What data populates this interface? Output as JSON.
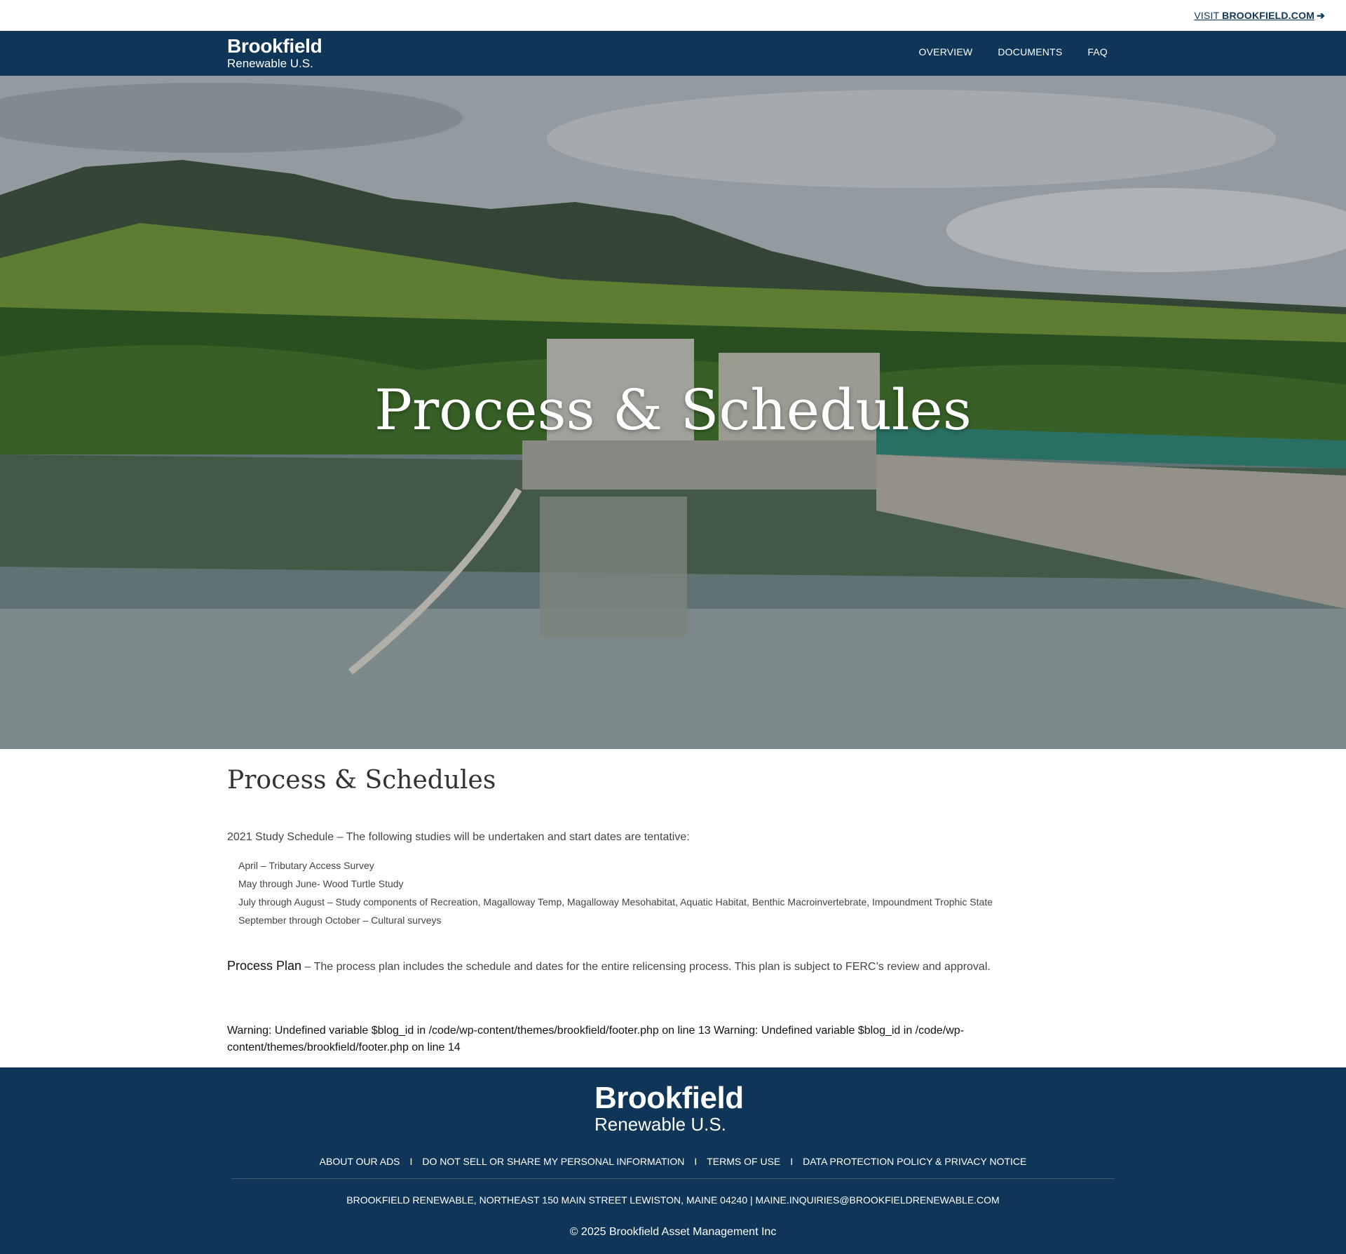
{
  "topbar": {
    "visit_prefix": "VISIT ",
    "visit_site": "BROOKFIELD.COM",
    "arrow_icon": "arrow-right-icon"
  },
  "header": {
    "logo_line1": "Brookfield",
    "logo_line2": "Renewable U.S.",
    "nav": [
      {
        "label": "OVERVIEW"
      },
      {
        "label": "DOCUMENTS"
      },
      {
        "label": "FAQ"
      }
    ]
  },
  "hero": {
    "title": "Process & Schedules"
  },
  "main": {
    "title": "Process & Schedules",
    "intro": "2021 Study Schedule – The following studies will be undertaken and start dates are tentative:",
    "schedule": [
      "April – Tributary Access Survey",
      "May through June- Wood Turtle Study",
      "July through August – Study components of Recreation, Magalloway Temp, Magalloway Mesohabitat, Aquatic Habitat, Benthic Macroinvertebrate, Impoundment Trophic State",
      "September through October – Cultural surveys"
    ],
    "process_link": "Process Plan",
    "process_text": " –  The process plan includes the schedule and dates for the entire relicensing process.  This plan is subject to FERC’s review and approval.",
    "warning": "Warning: Undefined variable $blog_id in /code/wp-content/themes/brookfield/footer.php on line 13 Warning: Undefined variable $blog_id in /code/wp-content/themes/brookfield/footer.php on line 14"
  },
  "footer": {
    "logo_line1": "Brookfield",
    "logo_line2": "Renewable U.S.",
    "links": [
      "ABOUT OUR ADS",
      "DO NOT SELL OR SHARE MY PERSONAL INFORMATION",
      "TERMS OF USE",
      "DATA PROTECTION POLICY & PRIVACY NOTICE"
    ],
    "separator": "I",
    "address": "BROOKFIELD RENEWABLE, NORTHEAST 150 MAIN STREET LEWISTON, MAINE 04240 | MAINE.INQUIRIES@BROOKFIELDRENEWABLE.COM",
    "copyright": "© 2025 Brookfield Asset Management Inc"
  },
  "colors": {
    "brand_navy": "#0f3558",
    "text": "#333333"
  }
}
